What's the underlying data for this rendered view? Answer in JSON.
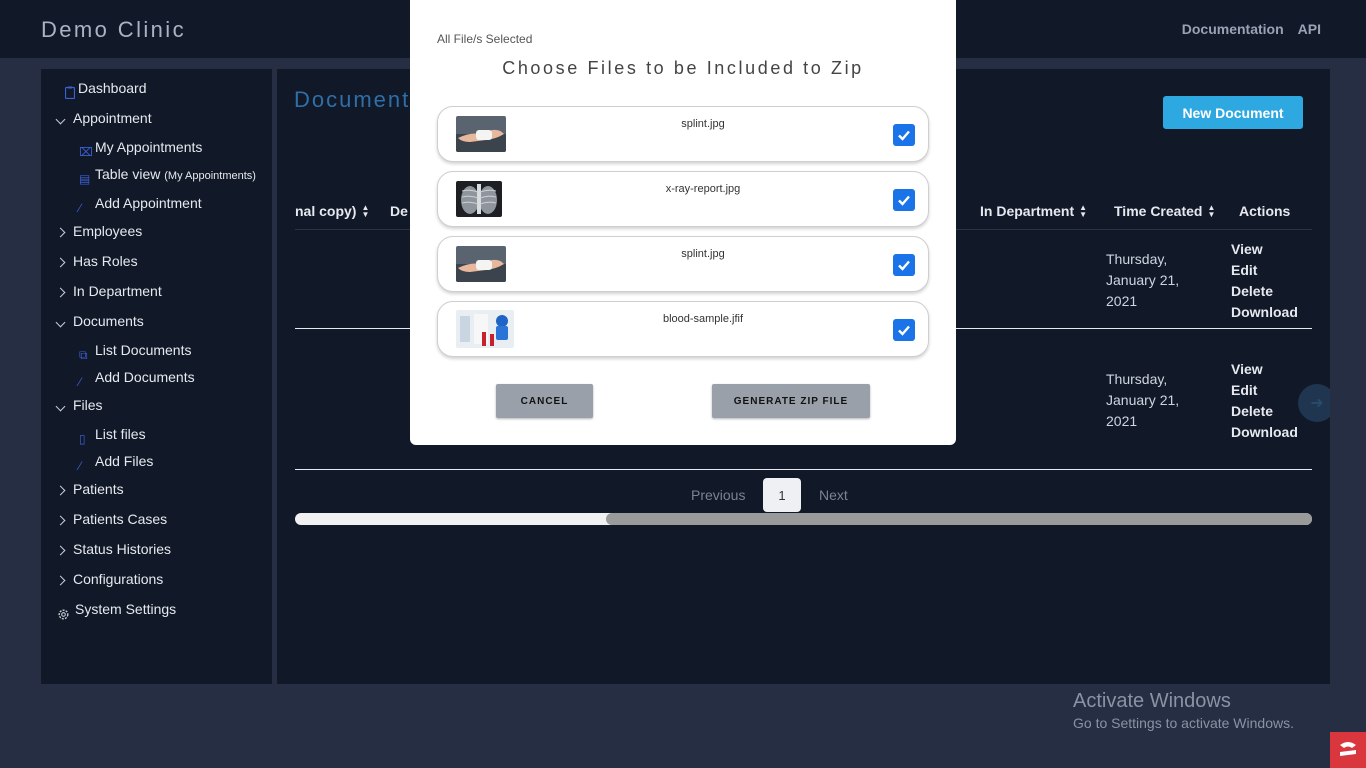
{
  "app": {
    "brand": "Demo Clinic"
  },
  "topnav": {
    "documentation": "Documentation",
    "api": "API"
  },
  "sidebar": {
    "dashboard": "Dashboard",
    "appointment": "Appointment",
    "my_appointments": "My Appointments",
    "table_view": "Table view",
    "table_view_note": "(My Appointments)",
    "add_appointment": "Add Appointment",
    "employees": "Employees",
    "has_roles": "Has Roles",
    "in_department": "In Department",
    "documents": "Documents",
    "list_documents": "List Documents",
    "add_documents": "Add Documents",
    "files": "Files",
    "list_files": "List files",
    "add_files": "Add Files",
    "patients": "Patients",
    "patients_cases": "Patients Cases",
    "status_histories": "Status Histories",
    "configurations": "Configurations",
    "system_settings": "System Settings"
  },
  "main": {
    "title": "Documents",
    "new_document": "New Document",
    "columns": {
      "original_copy": "nal copy)",
      "dept_partial": "De",
      "in_department": "In Department",
      "time_created": "Time Created",
      "actions": "Actions"
    },
    "rows": [
      {
        "date_line1": "Thursday,",
        "date_line2": "January 21,",
        "date_line3": "2021"
      },
      {
        "date_line1": "Thursday,",
        "date_line2": "January 21,",
        "date_line3": "2021"
      }
    ],
    "actions": {
      "view": "View",
      "edit": "Edit",
      "delete": "Delete",
      "download": "Download"
    },
    "pagination": {
      "previous": "Previous",
      "current": "1",
      "next": "Next"
    }
  },
  "modal": {
    "status": "All File/s Selected",
    "title": "Choose Files to be Included to Zip",
    "files": [
      {
        "name": "splint.jpg",
        "checked": true
      },
      {
        "name": "x-ray-report.jpg",
        "checked": true
      },
      {
        "name": "splint.jpg",
        "checked": true
      },
      {
        "name": "blood-sample.jfif",
        "checked": true
      }
    ],
    "cancel": "CANCEL",
    "generate": "GENERATE ZIP FILE"
  },
  "watermark": {
    "title": "Activate Windows",
    "subtitle": "Go to Settings to activate Windows."
  },
  "colors": {
    "accent": "#2ea8e0",
    "checkbox": "#1a73e8",
    "panel": "#111827",
    "background": "#252e42"
  }
}
